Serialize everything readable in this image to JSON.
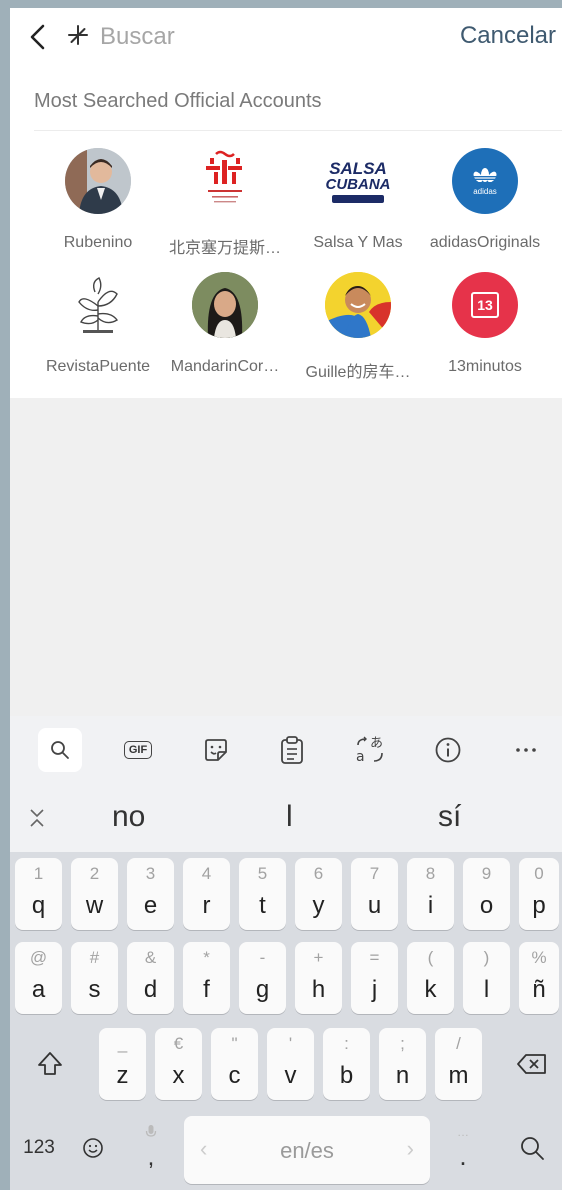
{
  "header": {
    "search_placeholder": "Buscar",
    "cancel_label": "Cancelar"
  },
  "section": {
    "title": "Most Searched Official Accounts",
    "accounts": [
      {
        "name": "Rubenino"
      },
      {
        "name": "北京塞万提斯…"
      },
      {
        "name": "Salsa Y Mas"
      },
      {
        "name": "adidasOriginals"
      },
      {
        "name": "RevistaPuente"
      },
      {
        "name": "MandarinCor…"
      },
      {
        "name": "Guille的房车…"
      },
      {
        "name": "13minutos"
      }
    ],
    "logo_text": {
      "salsa_top": "SALSA",
      "salsa_bottom": "CUBANA",
      "adidas": "adidas",
      "thirteen": "13"
    }
  },
  "keyboard": {
    "toolbar": {
      "gif_label": "GIF"
    },
    "suggestions": [
      "no",
      "l",
      "sí"
    ],
    "row1": [
      [
        "1",
        "q"
      ],
      [
        "2",
        "w"
      ],
      [
        "3",
        "e"
      ],
      [
        "4",
        "r"
      ],
      [
        "5",
        "t"
      ],
      [
        "6",
        "y"
      ],
      [
        "7",
        "u"
      ],
      [
        "8",
        "i"
      ],
      [
        "9",
        "o"
      ],
      [
        "0",
        "p"
      ]
    ],
    "row2": [
      [
        "@",
        "a"
      ],
      [
        "#",
        "s"
      ],
      [
        "&",
        "d"
      ],
      [
        "*",
        "f"
      ],
      [
        "-",
        "g"
      ],
      [
        "+",
        "h"
      ],
      [
        "=",
        "j"
      ],
      [
        "(",
        "k"
      ],
      [
        ")",
        "l"
      ],
      [
        "%",
        "ñ"
      ]
    ],
    "row3": [
      [
        "_",
        "z"
      ],
      [
        "€",
        "x"
      ],
      [
        "\"",
        "c"
      ],
      [
        "'",
        "v"
      ],
      [
        ":",
        "b"
      ],
      [
        ";",
        "n"
      ],
      [
        "/",
        "m"
      ]
    ],
    "num_label": "123",
    "space_label": "en/es",
    "comma_label": ",",
    "period_label": ".",
    "period_hint": "…"
  },
  "colors": {
    "cancel": "#3f5a70",
    "adidas_bg": "#1e6fb8",
    "thirteen_bg": "#e6334a"
  }
}
